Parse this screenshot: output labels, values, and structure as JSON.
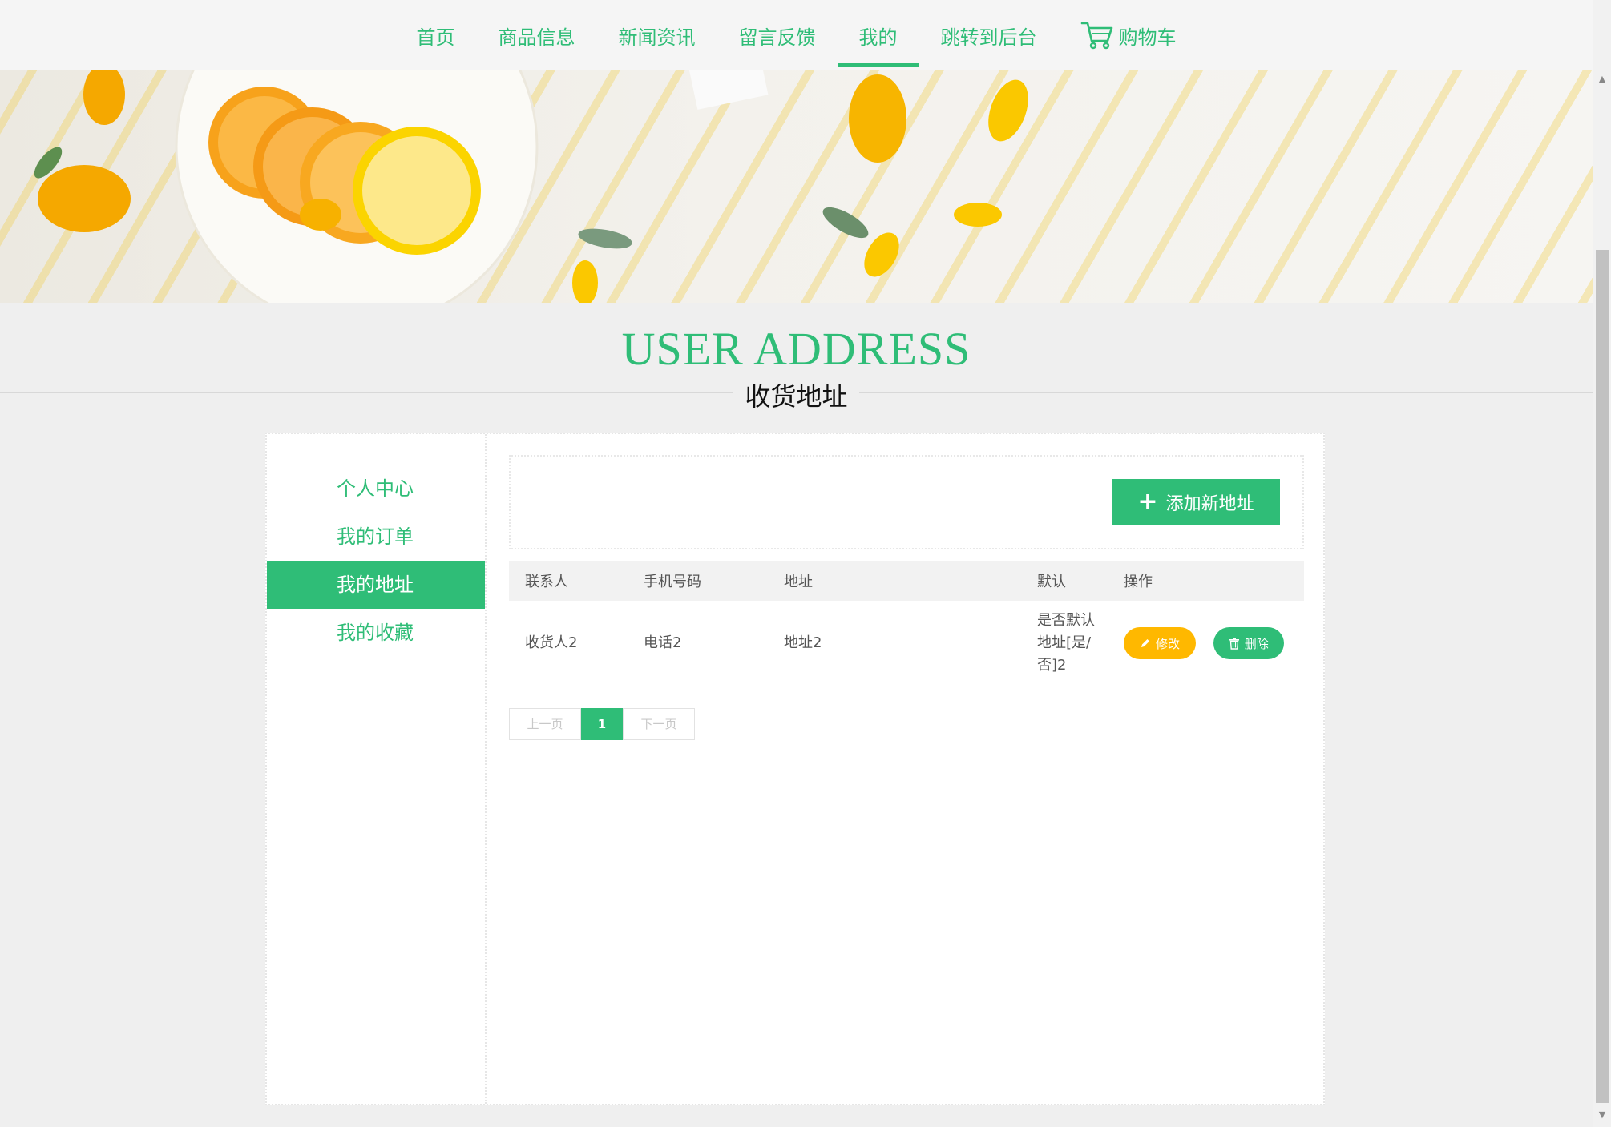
{
  "nav": {
    "items": [
      "首页",
      "商品信息",
      "新闻资讯",
      "留言反馈",
      "我的",
      "跳转到后台"
    ],
    "active_index": 4,
    "cart_label": "购物车",
    "cart_icon": "cart-icon"
  },
  "heading": {
    "title_en": "USER ADDRESS",
    "title_zh": "收货地址"
  },
  "sidebar": {
    "items": [
      {
        "label": "个人中心"
      },
      {
        "label": "我的订单"
      },
      {
        "label": "我的地址",
        "active": true
      },
      {
        "label": "我的收藏"
      }
    ]
  },
  "toolbar": {
    "add_label": "添加新地址",
    "add_icon": "plus-icon"
  },
  "table": {
    "headers": [
      "联系人",
      "手机号码",
      "地址",
      "默认",
      "操作"
    ],
    "rows": [
      {
        "contact": "收货人2",
        "phone": "电话2",
        "address": "地址2",
        "default": "是否默认地址[是/否]2",
        "edit_label": "修改",
        "delete_label": "删除"
      }
    ]
  },
  "pagination": {
    "prev_label": "上一页",
    "current": "1",
    "next_label": "下一页"
  },
  "colors": {
    "accent": "#2fbd77",
    "edit_button": "#ffb800"
  }
}
